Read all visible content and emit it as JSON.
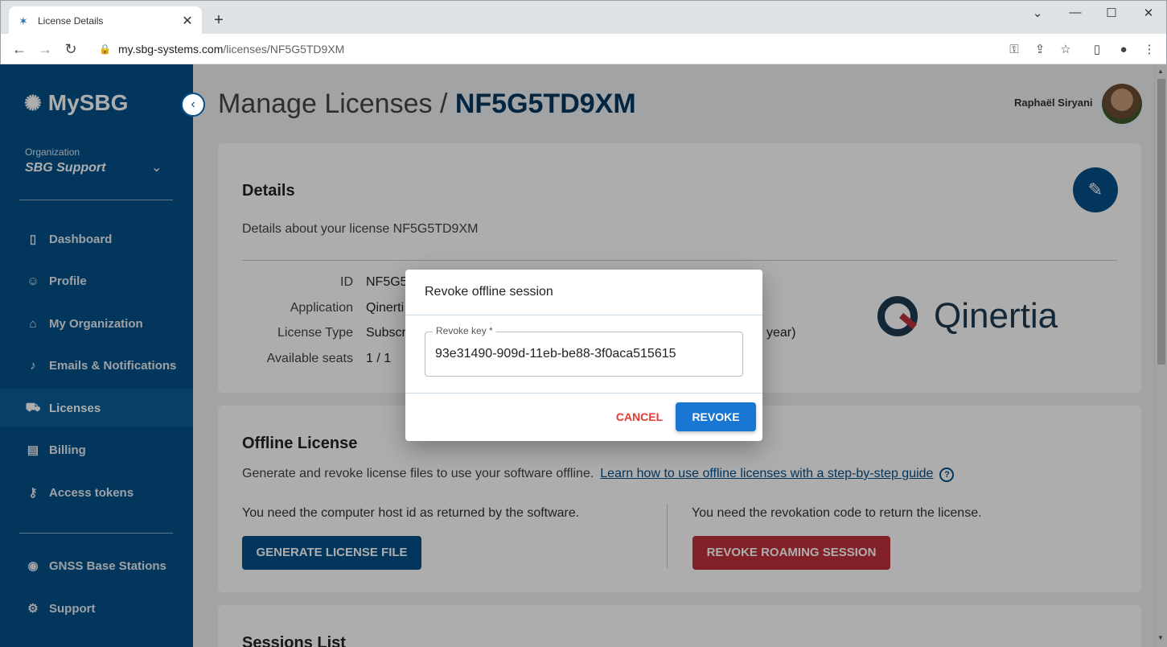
{
  "browser": {
    "tab_title": "License Details",
    "url_domain": "my.sbg-systems.com",
    "url_path": "/licenses/NF5G5TD9XM",
    "new_tab": "+",
    "tab_close": "✕"
  },
  "sidebar": {
    "logo": "MySBG",
    "org_label": "Organization",
    "org_name": "SBG Support",
    "items": [
      {
        "label": "Dashboard",
        "icon": "bar-chart-icon"
      },
      {
        "label": "Profile",
        "icon": "person-icon"
      },
      {
        "label": "My Organization",
        "icon": "bank-icon"
      },
      {
        "label": "Emails & Notifications",
        "icon": "bell-icon"
      },
      {
        "label": "Licenses",
        "icon": "cart-icon",
        "active": true
      },
      {
        "label": "Billing",
        "icon": "billing-icon"
      },
      {
        "label": "Access tokens",
        "icon": "key-icon"
      },
      {
        "label": "GNSS Base Stations",
        "icon": "location-icon"
      },
      {
        "label": "Support",
        "icon": "gear-icon"
      }
    ]
  },
  "header": {
    "title_prefix": "Manage Licenses / ",
    "title_id": "NF5G5TD9XM",
    "user_name": "Raphaël Siryani"
  },
  "details": {
    "heading": "Details",
    "subtitle": "Details about your license NF5G5TD9XM",
    "rows": [
      {
        "label": "ID",
        "value": "NF5G5"
      },
      {
        "label": "Application",
        "value": "Qinerti"
      },
      {
        "label": "License Type",
        "value": "Subscr"
      },
      {
        "label": "Available seats",
        "value": "1 / 1"
      }
    ],
    "license_type_tail": "year)",
    "product_logo": "Qinertia"
  },
  "offline": {
    "heading": "Offline License",
    "subtitle": "Generate and revoke license files to use your software offline.",
    "guide_link": "Learn how to use offline licenses with a step-by-step guide",
    "help": "?",
    "left_text": "You need the computer host id as returned by the software.",
    "right_text": "You need the revokation code to return the license.",
    "generate_button": "GENERATE LICENSE FILE",
    "revoke_roaming_button": "REVOKE ROAMING SESSION"
  },
  "sessions": {
    "heading": "Sessions List"
  },
  "dialog": {
    "title": "Revoke offline session",
    "field_label": "Revoke key *",
    "field_value": "93e31490-909d-11eb-be88-3f0aca515615",
    "cancel": "CANCEL",
    "revoke": "REVOKE"
  },
  "colors": {
    "sidebar": "#05508a",
    "primary": "#1976d2",
    "danger": "#c0303a"
  }
}
